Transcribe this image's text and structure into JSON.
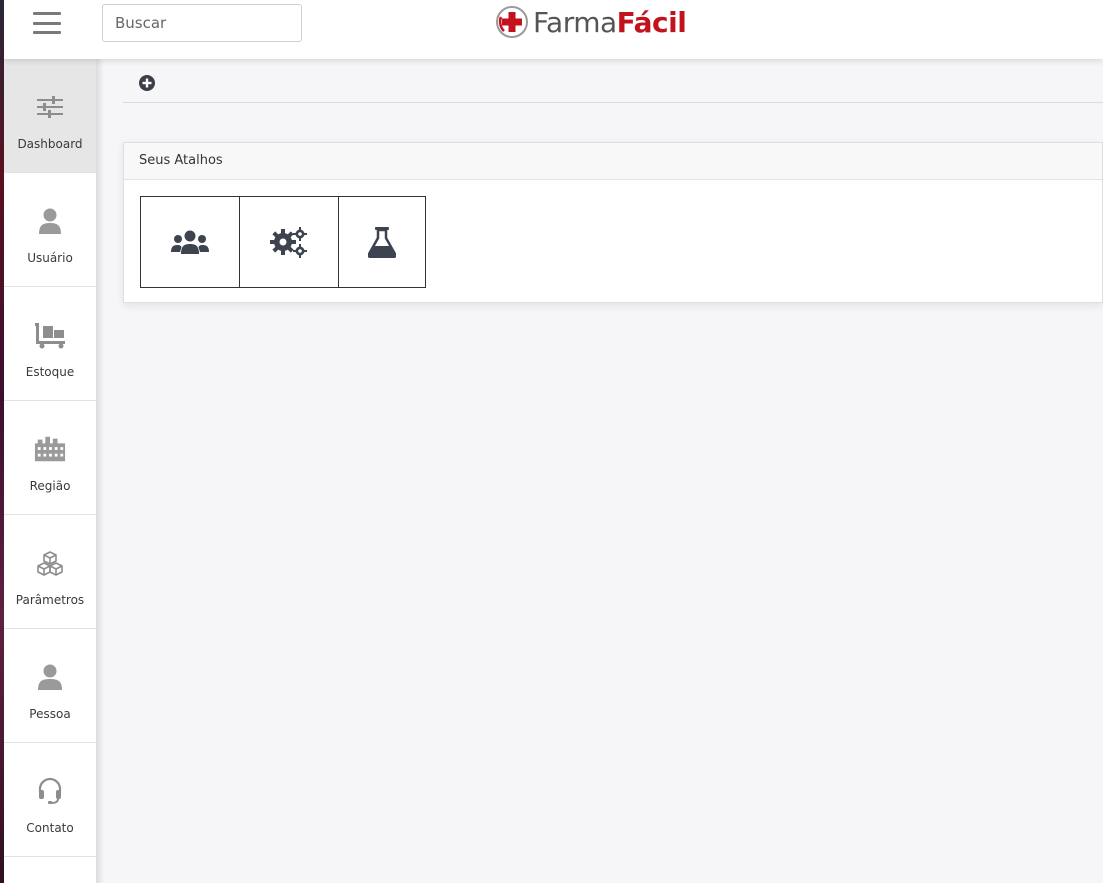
{
  "header": {
    "search_placeholder": "Buscar",
    "logo": {
      "part1": "Farma",
      "part2": "Fácil"
    },
    "brand_color": "#c2121d"
  },
  "sidebar": {
    "items": [
      {
        "label": "Dashboard",
        "icon": "sliders-icon",
        "active": true
      },
      {
        "label": "Usuário",
        "icon": "user-icon"
      },
      {
        "label": "Estoque",
        "icon": "dolly-icon"
      },
      {
        "label": "Região",
        "icon": "industry-icon"
      },
      {
        "label": "Parâmetros",
        "icon": "cubes-icon"
      },
      {
        "label": "Pessoa",
        "icon": "user-icon"
      },
      {
        "label": "Contato",
        "icon": "headset-icon"
      }
    ]
  },
  "toolbar": {
    "add_icon": "plus-circle-icon"
  },
  "shortcuts_card": {
    "title": "Seus Atalhos",
    "items": [
      {
        "icon": "users-icon"
      },
      {
        "icon": "cogs-icon"
      },
      {
        "icon": "flask-icon"
      }
    ]
  }
}
